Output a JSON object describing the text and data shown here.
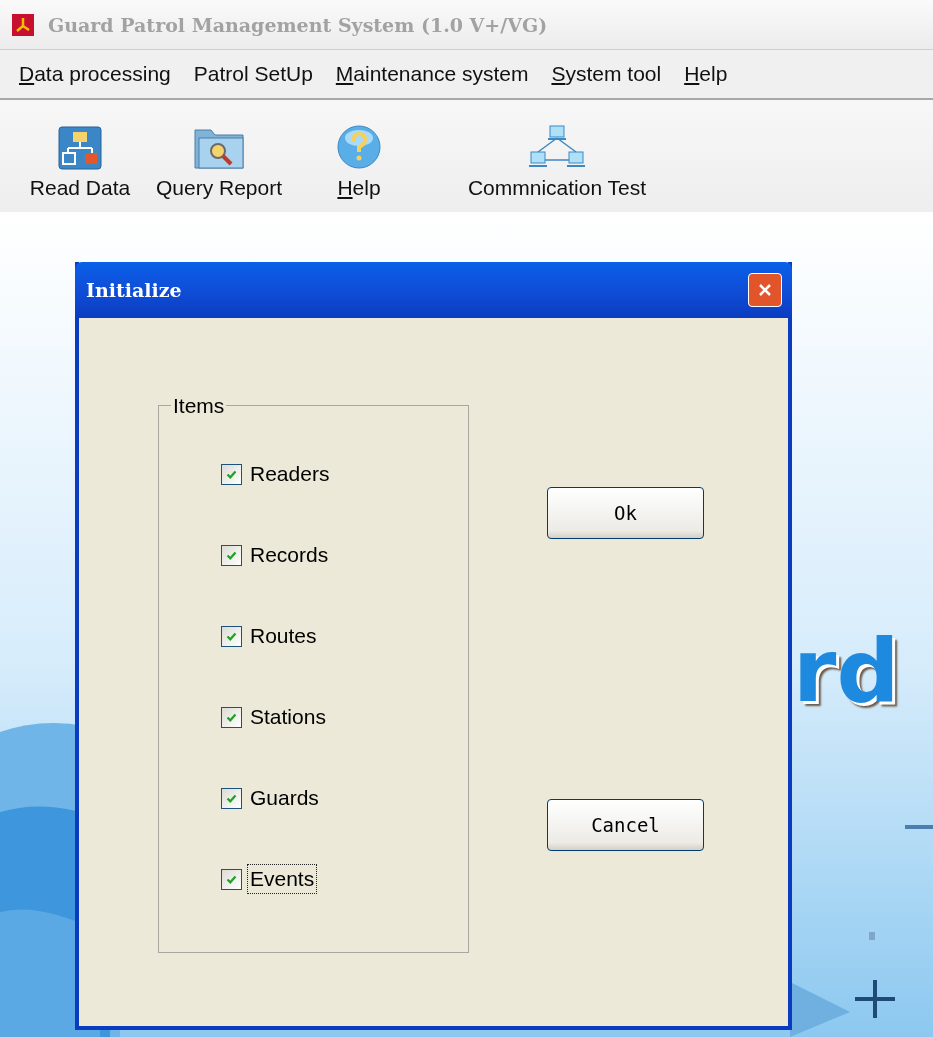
{
  "window": {
    "title": "Guard Patrol Management System (1.0 V+/VG)",
    "active": false
  },
  "menu": [
    {
      "label": "Data processing",
      "mnemonic": true
    },
    {
      "label": "Patrol SetUp",
      "mnemonic": false
    },
    {
      "label": "Maintenance system",
      "mnemonic": true
    },
    {
      "label": "System tool",
      "mnemonic": true
    },
    {
      "label": "Help",
      "mnemonic": true
    }
  ],
  "toolbar": [
    {
      "kind": "read",
      "label": "Read Data",
      "mnemonic": false
    },
    {
      "kind": "query",
      "label": "Query Report",
      "mnemonic": false
    },
    {
      "kind": "help",
      "label": "Help",
      "mnemonic": true
    },
    {
      "kind": "network",
      "label": "Commnication Test",
      "mnemonic": false
    }
  ],
  "background": {
    "kind": "picture",
    "logo_text": "rd"
  },
  "dialog": {
    "title": "Initialize",
    "group": {
      "label": "Items",
      "items": [
        {
          "label": "Readers",
          "checked": true,
          "focused": false
        },
        {
          "label": "Records",
          "checked": true,
          "focused": false
        },
        {
          "label": "Routes",
          "checked": true,
          "focused": false
        },
        {
          "label": "Stations",
          "checked": true,
          "focused": false
        },
        {
          "label": "Guards",
          "checked": true,
          "focused": false
        },
        {
          "label": "Events",
          "checked": true,
          "focused": true
        }
      ]
    },
    "buttons": [
      {
        "label": "Ok"
      },
      {
        "label": "Cancel"
      }
    ]
  }
}
